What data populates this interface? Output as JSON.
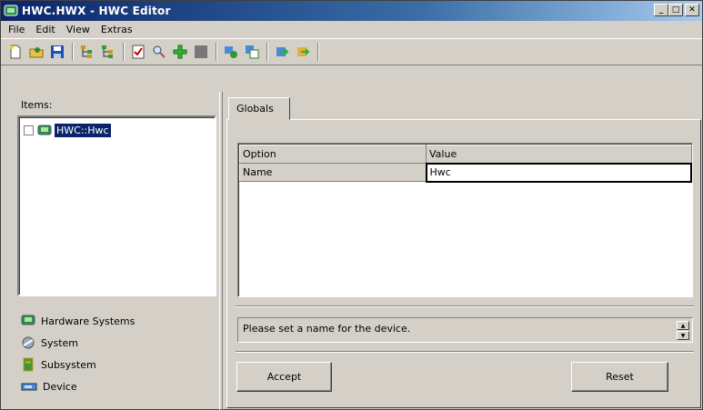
{
  "window": {
    "title": "HWC.HWX - HWC Editor"
  },
  "window_buttons": {
    "minimize": "_",
    "maximize": "□",
    "close": "✕"
  },
  "menu": [
    "File",
    "Edit",
    "View",
    "Extras"
  ],
  "toolbar": {
    "icons": [
      "new-icon",
      "open-icon",
      "save-icon",
      "tree-icon",
      "tree-alt-icon",
      "check-icon",
      "search-icon",
      "add-icon",
      "stop-icon",
      "export-icon",
      "copy-icon",
      "import-icon",
      "forward-icon"
    ]
  },
  "left": {
    "items_label": "Items:",
    "tree": {
      "node_label": "HWC::Hwc",
      "checked": false
    },
    "legend": [
      {
        "label": "Hardware Systems",
        "icon": "hardware-systems-icon"
      },
      {
        "label": "System",
        "icon": "system-icon"
      },
      {
        "label": "Subsystem",
        "icon": "subsystem-icon"
      },
      {
        "label": "Device",
        "icon": "device-icon"
      }
    ]
  },
  "right": {
    "tab_label": "Globals",
    "grid": {
      "headers": [
        "Option",
        "Value"
      ],
      "rows": [
        {
          "option": "Name",
          "value": "Hwc"
        }
      ]
    },
    "hint": "Please set a name for the device.",
    "accept_label": "Accept",
    "reset_label": "Reset"
  },
  "colors": {
    "title_start": "#0a246a",
    "title_end": "#a6caf0",
    "face": "#d4d0c8",
    "selection": "#0a246a"
  }
}
